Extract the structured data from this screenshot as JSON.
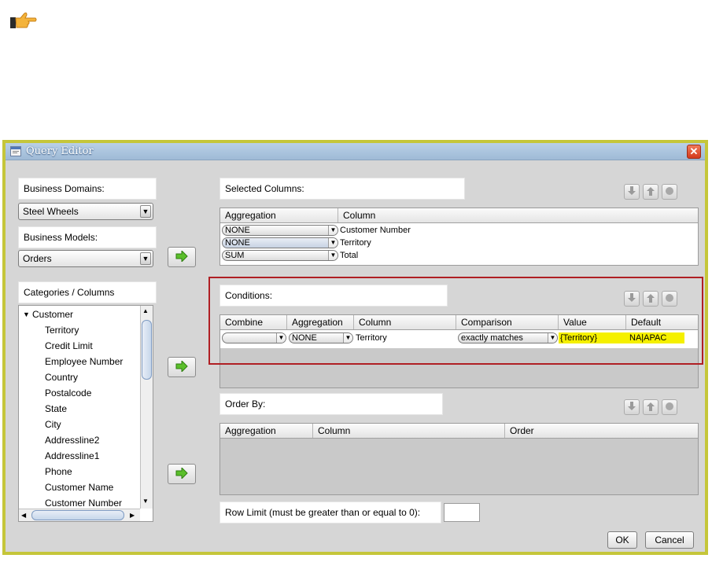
{
  "icons": {
    "pointer": "pointing-hand-icon",
    "move_right": "green-arrow-right-icon",
    "move_down": "arrow-down-icon",
    "move_up": "arrow-up-icon",
    "remove": "circle-remove-icon",
    "window": "app-window-icon"
  },
  "colors": {
    "dialog_border": "#c5c63a",
    "highlight": "#f5f000",
    "conditions_outline": "#b01f24",
    "arrow_green": "#5bbf2b"
  },
  "window": {
    "title": "Query Editor",
    "close_glyph": "✕"
  },
  "left": {
    "business_domains_label": "Business Domains:",
    "business_domain_value": "Steel Wheels",
    "business_models_label": "Business Models:",
    "business_model_value": "Orders",
    "categories_label": "Categories / Columns",
    "tree": {
      "category": "Customer",
      "items": [
        "Territory",
        "Credit Limit",
        "Employee Number",
        "Country",
        "Postalcode",
        "State",
        "City",
        "Addressline2",
        "Addressline1",
        "Phone",
        "Customer Name",
        "Customer Number"
      ]
    }
  },
  "selected_columns": {
    "label": "Selected Columns:",
    "headers": [
      "Aggregation",
      "Column"
    ],
    "rows": [
      {
        "aggregation": "NONE",
        "column": "Customer Number"
      },
      {
        "aggregation": "NONE",
        "column": "Territory"
      },
      {
        "aggregation": "SUM",
        "column": "Total"
      }
    ]
  },
  "conditions": {
    "label": "Conditions:",
    "headers": [
      "Combine",
      "Aggregation",
      "Column",
      "Comparison",
      "Value",
      "Default"
    ],
    "rows": [
      {
        "combine": "",
        "aggregation": "NONE",
        "column": "Territory",
        "comparison": "exactly matches",
        "value": "{Territory}",
        "default": "NA|APAC"
      }
    ]
  },
  "order_by": {
    "label": "Order By:",
    "headers": [
      "Aggregation",
      "Column",
      "Order"
    ]
  },
  "row_limit": {
    "label": "Row Limit (must be greater than or equal to 0):",
    "value": ""
  },
  "buttons": {
    "ok": "OK",
    "cancel": "Cancel"
  }
}
